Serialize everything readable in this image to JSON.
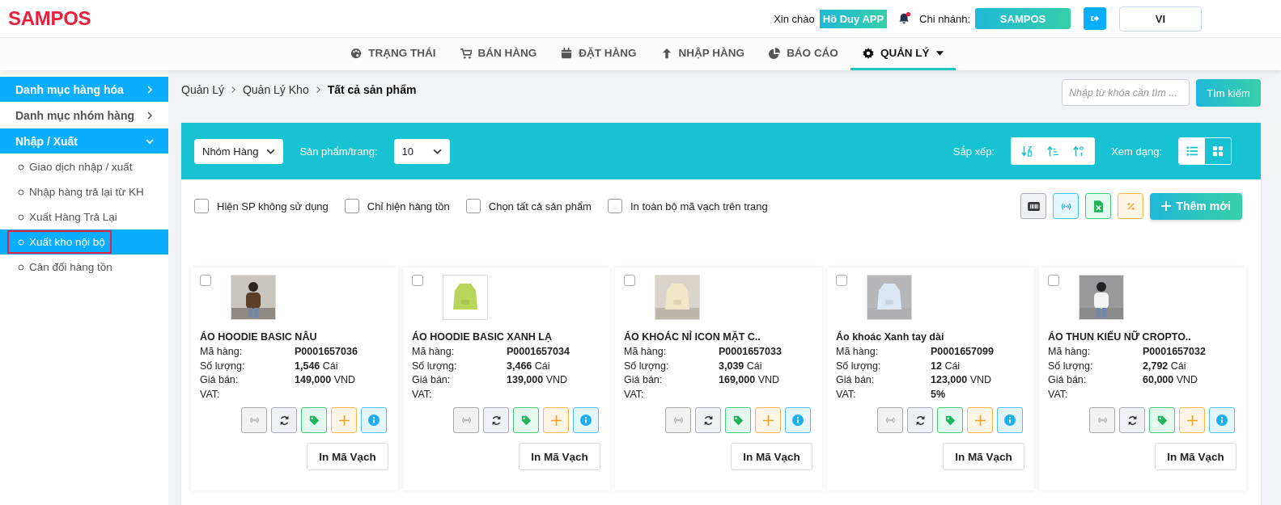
{
  "header": {
    "logo": "SAMPOS",
    "greeting": "Xin chào",
    "user": "Hồ Duy APP",
    "branch_label": "Chi nhánh:",
    "branch": "SAMPOS",
    "language": "VI"
  },
  "nav": [
    {
      "label": "TRẠNG THÁI",
      "selected": false,
      "dropdown": false
    },
    {
      "label": "BÁN HÀNG",
      "selected": false,
      "dropdown": false
    },
    {
      "label": "ĐẶT HÀNG",
      "selected": false,
      "dropdown": false
    },
    {
      "label": "NHẬP HÀNG",
      "selected": false,
      "dropdown": false
    },
    {
      "label": "BÁO CÁO",
      "selected": false,
      "dropdown": false
    },
    {
      "label": "QUẢN LÝ",
      "selected": true,
      "dropdown": true
    }
  ],
  "sidebar": {
    "items": [
      {
        "label": "Danh mục hàng hóa",
        "selected": true,
        "expanded": false
      },
      {
        "label": "Danh mục nhóm hàng",
        "selected": false,
        "expanded": false
      },
      {
        "label": "Nhập / Xuất",
        "selected": true,
        "expanded": true,
        "children": [
          {
            "label": "Giao dịch nhập / xuất",
            "selected": false
          },
          {
            "label": "Nhập hàng trả lại từ KH",
            "selected": false
          },
          {
            "label": "Xuất Hàng Trả Lại",
            "selected": false
          },
          {
            "label": "Xuất kho nội bộ",
            "selected": true
          },
          {
            "label": "Cân đối hàng tồn",
            "selected": false
          }
        ]
      }
    ]
  },
  "breadcrumb": [
    "Quản Lý",
    "Quản Lý Kho",
    "Tất cả sản phẩm"
  ],
  "search": {
    "placeholder": "Nhập từ khóa cần tìm ...",
    "button": "Tìm kiếm"
  },
  "filter": {
    "group": "Nhóm Hàng",
    "per_page_label": "Sản phẩm/trang:",
    "per_page": "10",
    "sort_label": "Sắp xếp:",
    "view_label": "Xem dạng:",
    "views": [
      {
        "selected": false
      },
      {
        "selected": true
      }
    ]
  },
  "options": [
    {
      "label": "Hiện SP không sử dụng",
      "checked": false
    },
    {
      "label": "Chỉ hiện hàng tồn",
      "checked": false
    },
    {
      "label": "Chọn tất cả sản phẩm",
      "checked": false
    },
    {
      "label": "In toàn bộ mã vạch trên trang",
      "checked": false
    }
  ],
  "add_button": "Thêm mới",
  "products": [
    {
      "name": "ÁO HOODIE BASIC NÂU",
      "checked": false,
      "code_label": "Mã hàng:",
      "code": "P0001657036",
      "qty_label": "Số lượng:",
      "qty": "**1,546** Cái",
      "price_label": "Giá bán:",
      "price": "**149,000** VND",
      "vat_label": "VAT:",
      "kind": "picture",
      "print": "In Mã Vạch"
    },
    {
      "name": "ÁO HOODIE BASIC XANH LẠ",
      "checked": false,
      "code_label": "Mã hàng:",
      "code": "P0001657034",
      "qty_label": "Số lượng:",
      "qty": "**3,466** Cái",
      "price_label": "Giá bán:",
      "price": "**139,000** VND",
      "vat_label": "VAT:",
      "kind": "picture",
      "print": "In Mã Vạch"
    },
    {
      "name": "ÁO KHOÁC NỈ ICON MẶT C..",
      "checked": false,
      "code_label": "Mã hàng:",
      "code": "P0001657033",
      "qty_label": "Số lượng:",
      "qty": "**3,039** Cái",
      "price_label": "Giá bán:",
      "price": "**169,000** VND",
      "vat_label": "VAT:",
      "kind": "picture",
      "print": "In Mã Vạch"
    },
    {
      "name": "Áo khoác Xanh tay dài",
      "checked": false,
      "code_label": "Mã hàng:",
      "code": "P0001657099",
      "qty_label": "Số lượng:",
      "qty": "**12** Cái",
      "price_label": "Giá bán:",
      "price": "**123,000** VND",
      "vat_label": "VAT:",
      "vat": "5%",
      "kind": "picture",
      "print": "In Mã Vạch"
    },
    {
      "name": "ÁO THUN KIỂU NỮ CROPTO..",
      "checked": false,
      "code_label": "Mã hàng:",
      "code": "P0001657032",
      "qty_label": "Số lượng:",
      "qty": "**2,792** Cái",
      "price_label": "Giá bán:",
      "price": "**60,000** VND",
      "vat_label": "VAT:",
      "kind": "picture",
      "print": "In Mã Vạch"
    }
  ]
}
